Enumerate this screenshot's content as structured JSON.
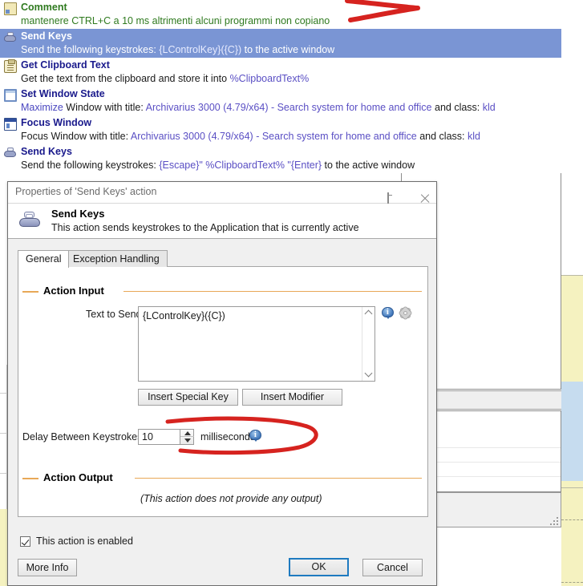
{
  "action_list": [
    {
      "icon": "comment-icon",
      "title": "Comment",
      "desc_plain": "mantenere CTRL+C a 10 ms altrimenti alcuni programmi non copiano",
      "style": "comment",
      "selected": false
    },
    {
      "icon": "send-keys-icon",
      "title": "Send Keys",
      "desc_prefix": "Send the following keystrokes: ",
      "desc_token": "{LControlKey}({C})",
      "desc_suffix": " to the active window",
      "style": "normal",
      "selected": true
    },
    {
      "icon": "clipboard-icon",
      "title": "Get Clipboard Text",
      "desc_prefix": "Get the text from the clipboard and store it into ",
      "desc_token": "%ClipboardText%",
      "desc_suffix": "",
      "style": "normal",
      "selected": false
    },
    {
      "icon": "set-window-state-icon",
      "title": "Set Window State",
      "desc_kw": "Maximize",
      "desc_prefix": " Window with title: ",
      "desc_token": "Archivarius 3000 (4.79/x64) - Search system for home and office",
      "desc_mid": " and class: ",
      "desc_token2": "kld",
      "style": "normal",
      "selected": false
    },
    {
      "icon": "focus-window-icon",
      "title": "Focus Window",
      "desc_prefix": "Focus Window with title: ",
      "desc_token": "Archivarius 3000 (4.79/x64) - Search system for home and office",
      "desc_mid": " and class: ",
      "desc_token2": "kld",
      "style": "normal",
      "selected": false
    },
    {
      "icon": "send-keys-icon",
      "title": "Send Keys",
      "desc_prefix": "Send the following keystrokes: ",
      "desc_token": "{Escape}\" %ClipboardText% \"{Enter}",
      "desc_suffix": " to the active window",
      "style": "normal",
      "selected": false
    }
  ],
  "dialog": {
    "titlebar": {
      "title": "Properties of 'Send Keys' action",
      "restore_icon": "restore-window-icon",
      "close_icon": "close-icon"
    },
    "header": {
      "icon": "send-keys-icon",
      "title": "Send Keys",
      "subtitle": "This action sends keystrokes to the Application that is currently active"
    },
    "tabs": [
      {
        "label": "General",
        "active": true
      },
      {
        "label": "Exception Handling",
        "active": false
      }
    ],
    "action_input": {
      "group_label": "Action Input",
      "text_to_send_label": "Text to Send:",
      "text_to_send_value": "{LControlKey}({C})",
      "insert_special_key_label": "Insert Special Key",
      "insert_modifier_label": "Insert Modifier",
      "delay_label": "Delay Between Keystrokes:",
      "delay_value": "10",
      "delay_units": "milliseconds",
      "info_icon": "info-icon",
      "gear_icon": "gear-icon"
    },
    "action_output": {
      "group_label": "Action Output",
      "note": "(This action does not provide any output)"
    },
    "footer": {
      "enabled_checkbox_label": "This action is enabled",
      "enabled_checked": true,
      "more_info_label": "More Info",
      "ok_label": "OK",
      "cancel_label": "Cancel"
    }
  },
  "annotations": {
    "arrow_mark": "red-arrow-annotation",
    "oval_mark": "red-oval-annotation",
    "color": "#d6231f"
  },
  "colors": {
    "selected_row": "#7a95d4",
    "comment_text": "#2f7a1f",
    "action_title": "#1a1a8c",
    "token": "#5a4fc4",
    "group_rule": "#e8a857",
    "primary_border": "#1e7ac0",
    "bg_yellow": "#f5f2c0",
    "bg_blue": "#c6dcef"
  }
}
